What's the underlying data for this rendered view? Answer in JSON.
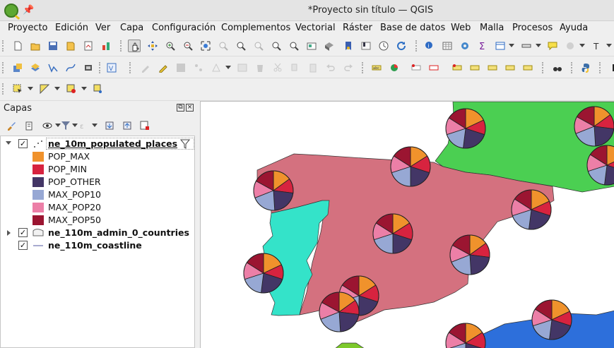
{
  "window": {
    "title": "*Proyecto sin título — QGIS"
  },
  "menubar": {
    "items": [
      "Proyecto",
      "Edición",
      "Ver",
      "Capa",
      "Configuración",
      "Complementos",
      "Vectorial",
      "Ráster",
      "Base de datos",
      "Web",
      "Malla",
      "Procesos",
      "Ayuda"
    ]
  },
  "layers_panel": {
    "title": "Capas",
    "layers": [
      {
        "name": "ne_10m_populated_places",
        "checked": true,
        "expanded": true,
        "filtered": true,
        "icon": "point-layer-icon",
        "legend": [
          {
            "label": "POP_MAX",
            "color": "#f0922c"
          },
          {
            "label": "POP_MIN",
            "color": "#d7233f"
          },
          {
            "label": "POP_OTHER",
            "color": "#433666"
          },
          {
            "label": "MAX_POP10",
            "color": "#97a8d4"
          },
          {
            "label": "MAX_POP20",
            "color": "#ec7fa7"
          },
          {
            "label": "MAX_POP50",
            "color": "#9b1531"
          }
        ]
      },
      {
        "name": "ne_110m_admin_0_countries",
        "checked": true,
        "expanded": false,
        "icon": "polygon-layer-icon"
      },
      {
        "name": "ne_110m_coastline",
        "checked": true,
        "expanded": false,
        "icon": "line-layer-icon"
      }
    ]
  },
  "map": {
    "colors": {
      "spain": "#d4717f",
      "portugal": "#34e3c9",
      "france": "#4bcf52",
      "sea": "#ffffff",
      "africa": "#2d6fdb",
      "algeria_fragment": "#7dc92c"
    }
  }
}
